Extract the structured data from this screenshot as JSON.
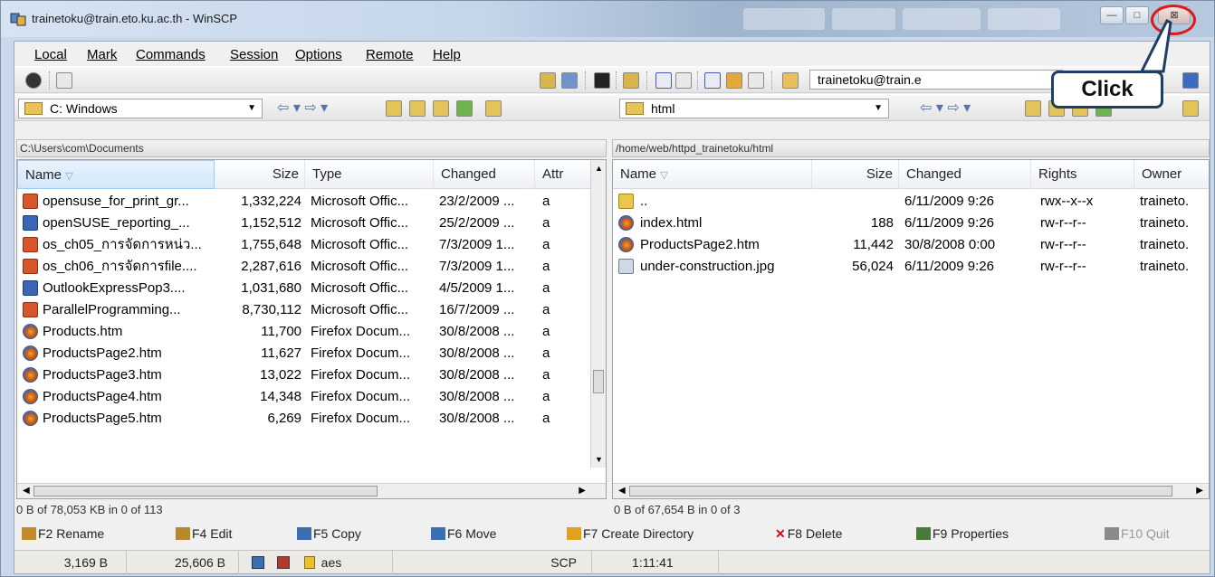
{
  "window": {
    "title": "trainetoku@train.eto.ku.ac.th - WinSCP",
    "buttons": {
      "minimize": "—",
      "maximize": "□",
      "close": "⊠"
    }
  },
  "menu": [
    "Local",
    "Mark",
    "Commands",
    "Session",
    "Options",
    "Remote",
    "Help"
  ],
  "session_combo": {
    "value": "trainetoku@train.e"
  },
  "callout": {
    "text": "Click"
  },
  "left_panel": {
    "drive": "C: Windows",
    "path": "C:\\Users\\com\\Documents",
    "columns": [
      "Name",
      "Size",
      "Type",
      "Changed",
      "Attr"
    ],
    "files": [
      {
        "icon": "ppt",
        "name": "opensuse_for_print_gr...",
        "size": "1,332,224",
        "type": "Microsoft Offic...",
        "changed": "23/2/2009  ...",
        "attr": "a"
      },
      {
        "icon": "doc",
        "name": "openSUSE_reporting_...",
        "size": "1,152,512",
        "type": "Microsoft Offic...",
        "changed": "25/2/2009  ...",
        "attr": "a"
      },
      {
        "icon": "ppt",
        "name": "os_ch05_การจัดการหน่ว...",
        "size": "1,755,648",
        "type": "Microsoft Offic...",
        "changed": "7/3/2009  1...",
        "attr": "a"
      },
      {
        "icon": "ppt",
        "name": "os_ch06_การจัดการfile....",
        "size": "2,287,616",
        "type": "Microsoft Offic...",
        "changed": "7/3/2009  1...",
        "attr": "a"
      },
      {
        "icon": "doc",
        "name": "OutlookExpressPop3....",
        "size": "1,031,680",
        "type": "Microsoft Offic...",
        "changed": "4/5/2009  1...",
        "attr": "a"
      },
      {
        "icon": "ppt",
        "name": "ParallelProgramming...",
        "size": "8,730,112",
        "type": "Microsoft Offic...",
        "changed": "16/7/2009  ...",
        "attr": "a"
      },
      {
        "icon": "htm",
        "name": "Products.htm",
        "size": "11,700",
        "type": "Firefox Docum...",
        "changed": "30/8/2008  ...",
        "attr": "a"
      },
      {
        "icon": "htm",
        "name": "ProductsPage2.htm",
        "size": "11,627",
        "type": "Firefox Docum...",
        "changed": "30/8/2008  ...",
        "attr": "a"
      },
      {
        "icon": "htm",
        "name": "ProductsPage3.htm",
        "size": "13,022",
        "type": "Firefox Docum...",
        "changed": "30/8/2008  ...",
        "attr": "a"
      },
      {
        "icon": "htm",
        "name": "ProductsPage4.htm",
        "size": "14,348",
        "type": "Firefox Docum...",
        "changed": "30/8/2008  ...",
        "attr": "a"
      },
      {
        "icon": "htm",
        "name": "ProductsPage5.htm",
        "size": "6,269",
        "type": "Firefox Docum...",
        "changed": "30/8/2008  ...",
        "attr": "a"
      }
    ],
    "status": "0 B of 78,053 KB in 0 of 113"
  },
  "right_panel": {
    "folder": "html",
    "path": "/home/web/httpd_trainetoku/html",
    "columns": [
      "Name",
      "Size",
      "Changed",
      "Rights",
      "Owner"
    ],
    "files": [
      {
        "icon": "up",
        "name": "..",
        "size": "",
        "changed": "6/11/2009 9:26",
        "rights": "rwx--x--x",
        "owner": "traineto."
      },
      {
        "icon": "htm",
        "name": "index.html",
        "size": "188",
        "changed": "6/11/2009 9:26",
        "rights": "rw-r--r--",
        "owner": "traineto."
      },
      {
        "icon": "htm",
        "name": "ProductsPage2.htm",
        "size": "11,442",
        "changed": "30/8/2008 0:00",
        "rights": "rw-r--r--",
        "owner": "traineto."
      },
      {
        "icon": "jpg",
        "name": "under-construction.jpg",
        "size": "56,024",
        "changed": "6/11/2009 9:26",
        "rights": "rw-r--r--",
        "owner": "traineto."
      }
    ],
    "status": "0 B of 67,654 B in 0 of 3"
  },
  "fkeys": [
    {
      "label": "F2 Rename",
      "color": "#c08a2a"
    },
    {
      "label": "F4 Edit",
      "color": "#b58a2a"
    },
    {
      "label": "F5 Copy",
      "color": "#3a6fb0"
    },
    {
      "label": "F6 Move",
      "color": "#3a6fb0"
    },
    {
      "label": "F7 Create Directory",
      "color": "#e0a020"
    },
    {
      "label": "F8 Delete",
      "color": "#d01010"
    },
    {
      "label": "F9 Properties",
      "color": "#4a7a3a"
    },
    {
      "label": "F10 Quit",
      "color": "#8a8a8a"
    }
  ],
  "statusbar": {
    "uploaded": "3,169 B",
    "downloaded": "25,606 B",
    "cipher": "aes",
    "protocol": "SCP",
    "time": "1:11:41"
  }
}
